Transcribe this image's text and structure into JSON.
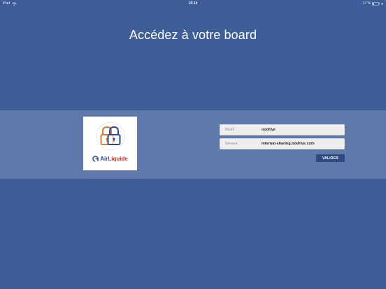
{
  "status_bar": {
    "device": "iPad",
    "time": "16:14",
    "battery": "17 %"
  },
  "title": "Accédez à votre board",
  "logo": {
    "brand_air": "Air",
    "brand_liquide": "Liquide"
  },
  "form": {
    "board_label": "Board",
    "board_value": "oodrive",
    "server_label": "Serveur",
    "server_value": "internal-sharing.oodrive.com",
    "submit_label": "VALIDER"
  },
  "colors": {
    "background": "#3f5d96",
    "band": "#5f79ab",
    "button": "#2f4a82",
    "lock_orange": "#e07a2e",
    "lock_blue": "#2b4a9a"
  }
}
